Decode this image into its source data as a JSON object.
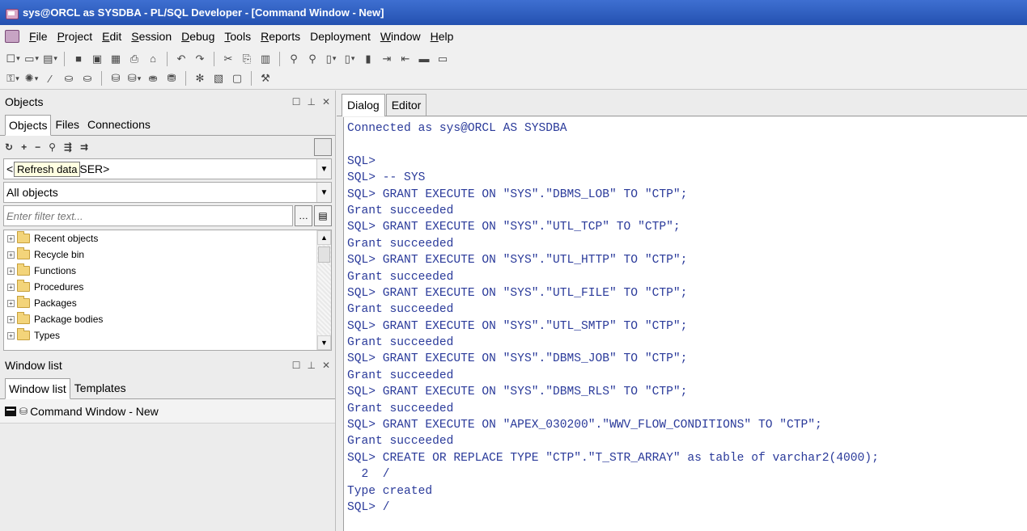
{
  "window": {
    "title": "sys@ORCL as SYSDBA - PL/SQL Developer - [Command Window - New]"
  },
  "menu": [
    {
      "pre": "",
      "ul": "F",
      "post": "ile"
    },
    {
      "pre": "",
      "ul": "P",
      "post": "roject"
    },
    {
      "pre": "",
      "ul": "E",
      "post": "dit"
    },
    {
      "pre": "",
      "ul": "S",
      "post": "ession"
    },
    {
      "pre": "",
      "ul": "D",
      "post": "ebug"
    },
    {
      "pre": "",
      "ul": "T",
      "post": "ools"
    },
    {
      "pre": "",
      "ul": "R",
      "post": "eports"
    },
    {
      "pre": "Deployment",
      "ul": "",
      "post": ""
    },
    {
      "pre": "",
      "ul": "W",
      "post": "indow"
    },
    {
      "pre": "",
      "ul": "H",
      "post": "elp"
    }
  ],
  "objects_pane": {
    "title": "Objects",
    "tabs": [
      "Objects",
      "Files",
      "Connections"
    ],
    "user_combo_value": "<CURRENT USER>",
    "tooltip": "Refresh data",
    "type_combo_value": "All objects",
    "filter_placeholder": "Enter filter text...",
    "tree": [
      "Recent objects",
      "Recycle bin",
      "Functions",
      "Procedures",
      "Packages",
      "Package bodies",
      "Types"
    ]
  },
  "window_list_pane": {
    "title": "Window list",
    "tabs": [
      "Window list",
      "Templates"
    ],
    "items": [
      "Command Window - New"
    ]
  },
  "command_window": {
    "tabs": [
      "Dialog",
      "Editor"
    ],
    "lines": [
      "Connected as sys@ORCL AS SYSDBA",
      "",
      "SQL>",
      "SQL> -- SYS",
      "SQL> GRANT EXECUTE ON \"SYS\".\"DBMS_LOB\" TO \"CTP\";",
      "Grant succeeded",
      "SQL> GRANT EXECUTE ON \"SYS\".\"UTL_TCP\" TO \"CTP\";",
      "Grant succeeded",
      "SQL> GRANT EXECUTE ON \"SYS\".\"UTL_HTTP\" TO \"CTP\";",
      "Grant succeeded",
      "SQL> GRANT EXECUTE ON \"SYS\".\"UTL_FILE\" TO \"CTP\";",
      "Grant succeeded",
      "SQL> GRANT EXECUTE ON \"SYS\".\"UTL_SMTP\" TO \"CTP\";",
      "Grant succeeded",
      "SQL> GRANT EXECUTE ON \"SYS\".\"DBMS_JOB\" TO \"CTP\";",
      "Grant succeeded",
      "SQL> GRANT EXECUTE ON \"SYS\".\"DBMS_RLS\" TO \"CTP\";",
      "Grant succeeded",
      "SQL> GRANT EXECUTE ON \"APEX_030200\".\"WWV_FLOW_CONDITIONS\" TO \"CTP\";",
      "Grant succeeded",
      "SQL> CREATE OR REPLACE TYPE \"CTP\".\"T_STR_ARRAY\" as table of varchar2(4000);",
      "  2  /",
      "Type created",
      "SQL> /"
    ]
  }
}
